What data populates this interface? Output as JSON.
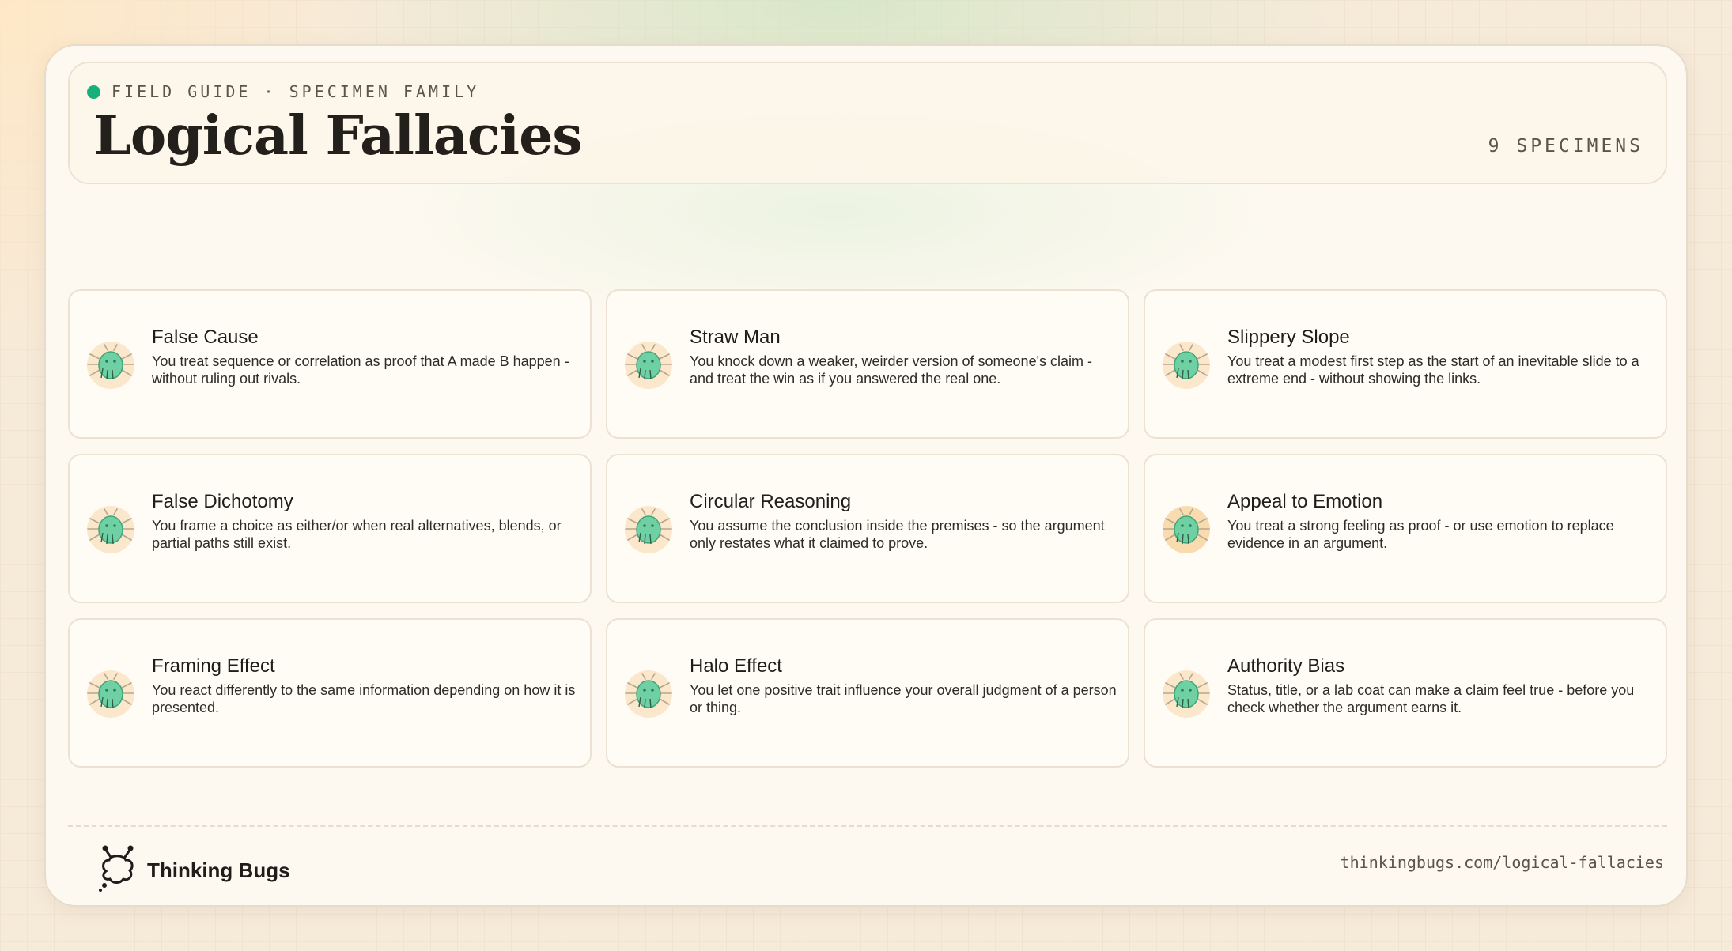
{
  "header": {
    "eyebrow": "FIELD GUIDE · SPECIMEN FAMILY",
    "title": "Logical Fallacies",
    "count": "9 SPECIMENS"
  },
  "specimens": [
    {
      "title": "False Cause",
      "description": "You treat sequence or correlation as proof that A made B happen - without ruling out rivals."
    },
    {
      "title": "Straw Man",
      "description": "You knock down a weaker, weirder version of someone's claim - and treat the win as if you answered the real one."
    },
    {
      "title": "Slippery Slope",
      "description": "You treat a modest first step as the start of an inevitable slide to a extreme end - without showing the links."
    },
    {
      "title": "False Dichotomy",
      "description": "You frame a choice as either/or when real alternatives, blends, or partial paths still exist."
    },
    {
      "title": "Circular Reasoning",
      "description": "You assume the conclusion inside the premises - so the argument only restates what it claimed to prove."
    },
    {
      "title": "Appeal to Emotion",
      "description": "You treat a strong feeling as proof - or use emotion to replace evidence in an argument."
    },
    {
      "title": "Framing Effect",
      "description": "You react differently to the same information depending on how it is presented."
    },
    {
      "title": "Halo Effect",
      "description": "You let one positive trait influence your overall judgment of a person or thing."
    },
    {
      "title": "Authority Bias",
      "description": "Status, title, or a lab coat can make a claim feel true - before you check whether the argument earns it."
    }
  ],
  "footer": {
    "brand": "Thinking Bugs",
    "url": "thinkingbugs.com/logical-fallacies"
  },
  "colors": {
    "accent_dot": "#16b07a",
    "bug_body": "#6fd0a4",
    "page_background": "#f6ead9",
    "card_background": "#fdf9f0"
  },
  "icons": {
    "specimen": "green-bug-icon",
    "brand": "thinking-bug-logo-icon"
  }
}
